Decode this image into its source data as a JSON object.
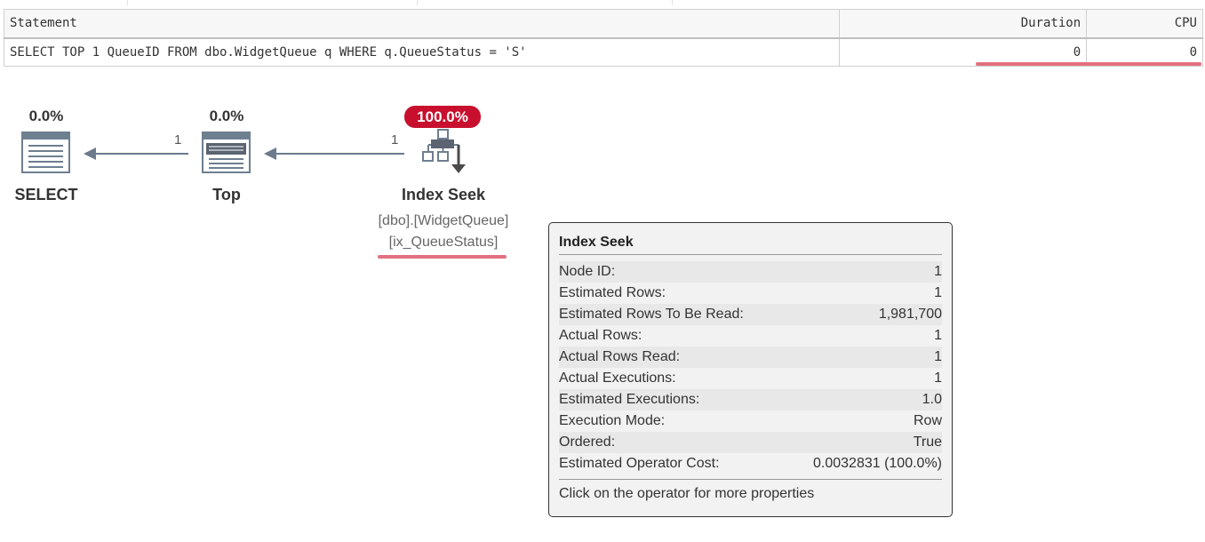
{
  "grid": {
    "headers": {
      "statement": "Statement",
      "duration": "Duration",
      "cpu": "CPU"
    },
    "row": {
      "statement": "SELECT TOP 1 QueueID FROM dbo.WidgetQueue q WHERE q.QueueStatus = 'S'",
      "duration": "0",
      "cpu": "0"
    }
  },
  "plan": {
    "select": {
      "cost": "0.0%",
      "label": "SELECT",
      "icon": "select-result-icon"
    },
    "top": {
      "cost": "0.0%",
      "label": "Top",
      "icon": "top-operator-icon"
    },
    "seek": {
      "cost": "100.0%",
      "label": "Index Seek",
      "object": "[dbo].[WidgetQueue]",
      "index": "[ix_QueueStatus]",
      "icon": "index-seek-icon"
    },
    "arrow_top_to_select_rows": "1",
    "arrow_seek_to_top_rows": "1"
  },
  "tooltip": {
    "title": "Index Seek",
    "rows": [
      {
        "label": "Node ID:",
        "value": "1"
      },
      {
        "label": "Estimated Rows:",
        "value": "1"
      },
      {
        "label": "Estimated Rows To Be Read:",
        "value": "1,981,700"
      },
      {
        "label": "Actual Rows:",
        "value": "1"
      },
      {
        "label": "Actual Rows Read:",
        "value": "1"
      },
      {
        "label": "Actual Executions:",
        "value": "1"
      },
      {
        "label": "Estimated Executions:",
        "value": "1.0"
      },
      {
        "label": "Execution Mode:",
        "value": "Row"
      },
      {
        "label": "Ordered:",
        "value": "True"
      },
      {
        "label": "Estimated Operator Cost:",
        "value": "0.0032831 (100.0%)"
      }
    ],
    "footer": "Click on the operator for more properties"
  },
  "colors": {
    "highlight": "#e2707f",
    "cost_badge": "#c8102e",
    "arrow": "#6b7b8c"
  }
}
